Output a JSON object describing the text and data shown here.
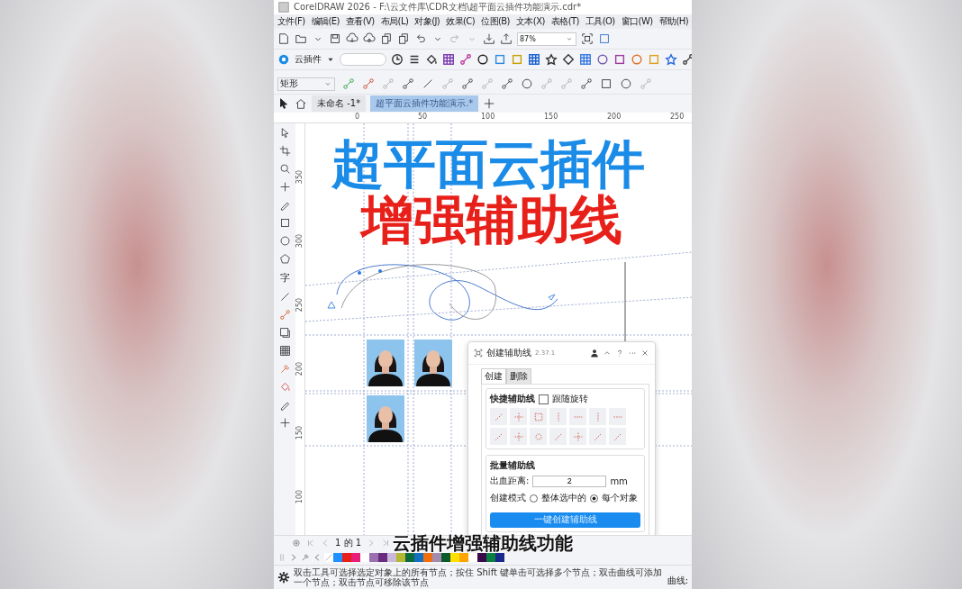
{
  "window": {
    "title": "CorelDRAW 2026 - F:\\云文件库\\CDR文档\\超平面云插件功能演示.cdr*"
  },
  "menu": [
    "文件(F)",
    "编辑(E)",
    "查看(V)",
    "布局(L)",
    "对象(J)",
    "效果(C)",
    "位图(B)",
    "文本(X)",
    "表格(T)",
    "工具(O)",
    "窗口(W)",
    "帮助(H)"
  ],
  "toolbar": {
    "zoom": "87%"
  },
  "plugin_bar": {
    "label": "云插件"
  },
  "property_bar": {
    "shape": "矩形"
  },
  "doc_tabs": [
    {
      "label": "未命名 -1*",
      "selected": false
    },
    {
      "label": "超平面云插件功能演示.*",
      "selected": true
    }
  ],
  "ruler": {
    "horizontal": [
      "0",
      "50",
      "100",
      "150",
      "200",
      "250"
    ],
    "vertical": [
      "350",
      "300",
      "250",
      "200",
      "150",
      "100"
    ]
  },
  "toolbox": {
    "text_tool": "字"
  },
  "canvas": {
    "title": "超平面云插件",
    "subtitle": "增强辅助线"
  },
  "dialog": {
    "title": "创建辅助线",
    "version": "2.37.1",
    "tabs": [
      {
        "label": "创建",
        "selected": true
      },
      {
        "label": "删除",
        "selected": false
      }
    ],
    "quick": {
      "heading": "快捷辅助线",
      "follow_rotation": {
        "label": "跟随旋转",
        "checked": false
      }
    },
    "batch": {
      "heading": "批量辅助线",
      "bleed_label": "出血距离:",
      "bleed_value": "2",
      "unit": "mm",
      "mode_label": "创建模式",
      "modes": [
        {
          "label": "整体选中的",
          "selected": false
        },
        {
          "label": "每个对象",
          "selected": true
        }
      ],
      "button": "一键创建辅助线"
    }
  },
  "caption": "云插件增强辅助线功能",
  "page_nav": "1 的 1",
  "palette": [
    {
      "color": "#1e90ff"
    },
    {
      "color": "#e8201a"
    },
    {
      "color": "#e81e78"
    },
    {
      "color": "#ffffff"
    },
    {
      "color": "#9b6fb0"
    },
    {
      "color": "#6a2c7f"
    },
    {
      "color": "#c9b8d8"
    },
    {
      "color": "#b5b830"
    },
    {
      "color": "#0a6b3c"
    },
    {
      "color": "#1470c0"
    },
    {
      "color": "#f07010"
    },
    {
      "color": "#a38bb0"
    },
    {
      "color": "#0a5a2a"
    },
    {
      "color": "#ffe000"
    },
    {
      "color": "#ffa500"
    },
    {
      "color": "#ffffff"
    },
    {
      "color": "#3a0a4a"
    },
    {
      "color": "#0a8040"
    },
    {
      "color": "#1a2a8a"
    }
  ],
  "status_bar": {
    "hint": "双击工具可选择选定对象上的所有节点；按住 Shift 键单击可选择多个节点；双击曲线可添加一个节点；双击节点可移除该节点",
    "object": "曲线:"
  }
}
